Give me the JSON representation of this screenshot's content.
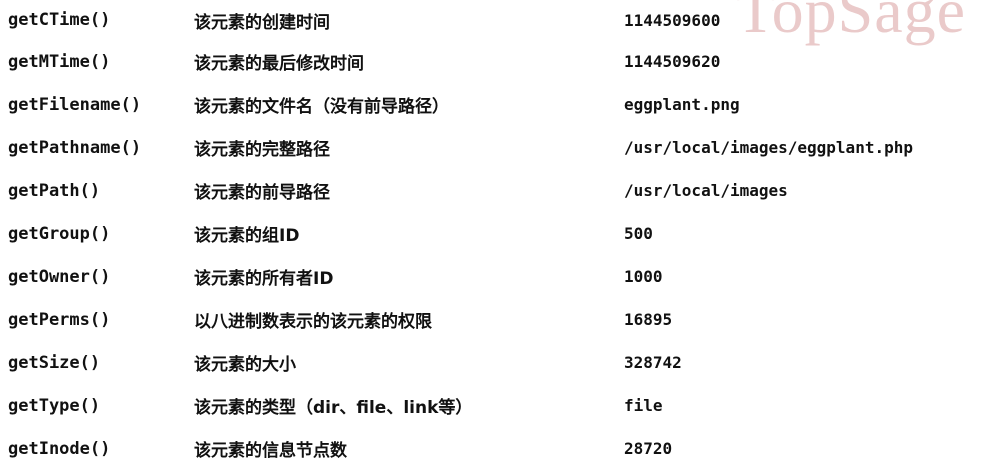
{
  "watermark": "TopSage",
  "rows": [
    {
      "method": "getCTime()",
      "description": "该元素的创建时间",
      "example": "1144509600"
    },
    {
      "method": "getMTime()",
      "description": "该元素的最后修改时间",
      "example": "1144509620"
    },
    {
      "method": "getFilename()",
      "description": "该元素的文件名（没有前导路径）",
      "example": "eggplant.png"
    },
    {
      "method": "getPathname()",
      "description": "该元素的完整路径",
      "example": "/usr/local/images/eggplant.php"
    },
    {
      "method": "getPath()",
      "description": "该元素的前导路径",
      "example": "/usr/local/images"
    },
    {
      "method": "getGroup()",
      "description": "该元素的组ID",
      "example": "500"
    },
    {
      "method": "getOwner()",
      "description": "该元素的所有者ID",
      "example": "1000"
    },
    {
      "method": "getPerms()",
      "description": "以八进制数表示的该元素的权限",
      "example": "16895"
    },
    {
      "method": "getSize()",
      "description": "该元素的大小",
      "example": "328742"
    },
    {
      "method": "getType()",
      "description": "该元素的类型（dir、file、link等）",
      "example": "file"
    },
    {
      "method": "getInode()",
      "description": "该元素的信息节点数",
      "example": "28720"
    }
  ]
}
